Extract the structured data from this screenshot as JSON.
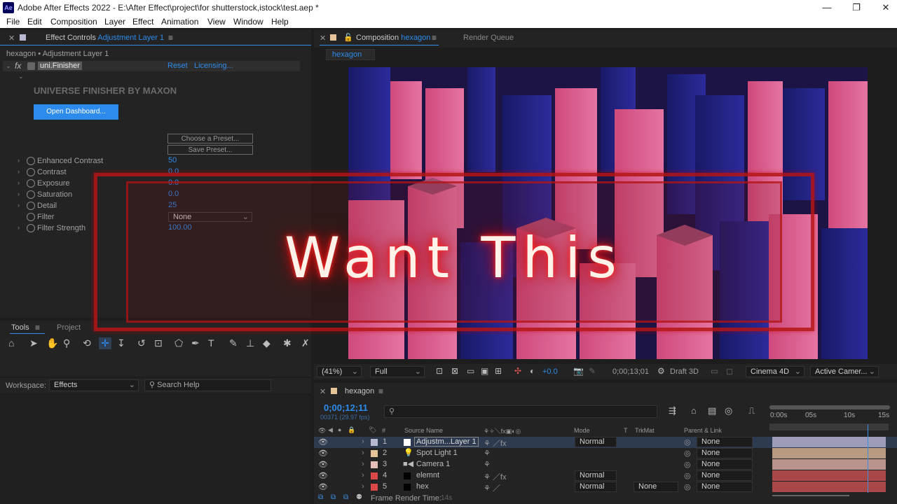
{
  "window": {
    "app_badge": "Ae",
    "title": "Adobe After Effects 2022 - E:\\After Effect\\project\\for shutterstock,istock\\test.aep *",
    "min": "—",
    "max": "❐",
    "close": "✕"
  },
  "menu": [
    "File",
    "Edit",
    "Composition",
    "Layer",
    "Effect",
    "Animation",
    "View",
    "Window",
    "Help"
  ],
  "effect_controls": {
    "tab_prefix": "Effect Controls",
    "tab_layer": "Adjustment Layer 1",
    "breadcrumb": "hexagon • Adjustment Layer 1",
    "fx_name": "uni.Finisher",
    "reset": "Reset",
    "licensing": "Licensing...",
    "brand": "UNIVERSE FINISHER BY MAXON",
    "dashboard": "Open Dashboard...",
    "choose_preset": "Choose a Preset...",
    "save_preset": "Save Preset...",
    "params": [
      {
        "label": "Enhanced Contrast",
        "value": "50"
      },
      {
        "label": "Contrast",
        "value": "0.0"
      },
      {
        "label": "Exposure",
        "value": "0.0"
      },
      {
        "label": "Saturation",
        "value": "0.0"
      },
      {
        "label": "Detail",
        "value": "25"
      },
      {
        "label": "Filter",
        "value": "None"
      },
      {
        "label": "Filter Strength",
        "value": "100.00"
      }
    ]
  },
  "tools": {
    "tab": "Tools",
    "project_tab": "Project",
    "workspace_label": "Workspace:",
    "workspace_value": "Effects",
    "search_placeholder": "Search Help"
  },
  "composition": {
    "tab_prefix": "Composition",
    "comp_name": "hexagon",
    "render_queue": "Render Queue",
    "crumb": "hexagon"
  },
  "overlay": {
    "headline": "Want This"
  },
  "viewer_bar": {
    "zoom": "(41%)",
    "resolution": "Full",
    "exposure": "+0.0",
    "timecode": "0;00;13;01",
    "draft": "Draft 3D",
    "renderer": "Cinema 4D",
    "camera": "Active Camer..."
  },
  "timeline": {
    "comp_tab": "hexagon",
    "timecode": "0;00;12;11",
    "frames": "00371 (29.97 fps)",
    "ruler": [
      "0:00s",
      "05s",
      "10s",
      "15s"
    ],
    "col_source": "Source Name",
    "col_mode": "Mode",
    "col_t": "T",
    "col_trkmat": "TrkMat",
    "col_parent": "Parent & Link",
    "layers": [
      {
        "num": "1",
        "name": "Adjustm...Layer 1",
        "mode": "Normal",
        "trkmat": "",
        "parent": "None",
        "label_color": "#b8b8d0",
        "bar_color": "#9c9cb8"
      },
      {
        "num": "2",
        "name": "Spot Light 1",
        "mode": "",
        "trkmat": "",
        "parent": "None",
        "label_color": "#e6c49a",
        "bar_color": "#b89a80"
      },
      {
        "num": "3",
        "name": "Camera 1",
        "mode": "",
        "trkmat": "",
        "parent": "None",
        "label_color": "#e6c0b8",
        "bar_color": "#b8948c"
      },
      {
        "num": "4",
        "name": "elemnt",
        "mode": "Normal",
        "trkmat": "",
        "parent": "None",
        "label_color": "#d84848",
        "bar_color": "#a84848"
      },
      {
        "num": "5",
        "name": "hex",
        "mode": "Normal",
        "trkmat": "None",
        "parent": "None",
        "label_color": "#d84848",
        "bar_color": "#a84848"
      }
    ],
    "frame_render_label": "Frame Render Time:",
    "frame_render_value": "14s"
  }
}
